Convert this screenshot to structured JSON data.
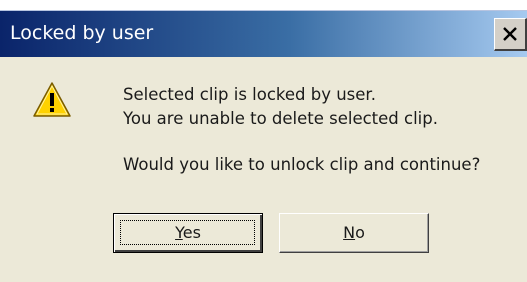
{
  "window": {
    "title": "Locked by user",
    "close_label": "close"
  },
  "icon": "warning-icon",
  "message": {
    "line1": "Selected clip is locked by user.",
    "line2": "You are unable to delete selected clip.",
    "line3": "Would you like to unlock clip and continue?"
  },
  "buttons": {
    "yes": {
      "mnemonic": "Y",
      "rest": "es"
    },
    "no": {
      "mnemonic": "N",
      "rest": "o"
    }
  },
  "colors": {
    "titlebar_start": "#0a246a",
    "titlebar_end": "#a6caf0",
    "dialog_bg": "#ece9d8",
    "warning_yellow": "#ffd200"
  }
}
